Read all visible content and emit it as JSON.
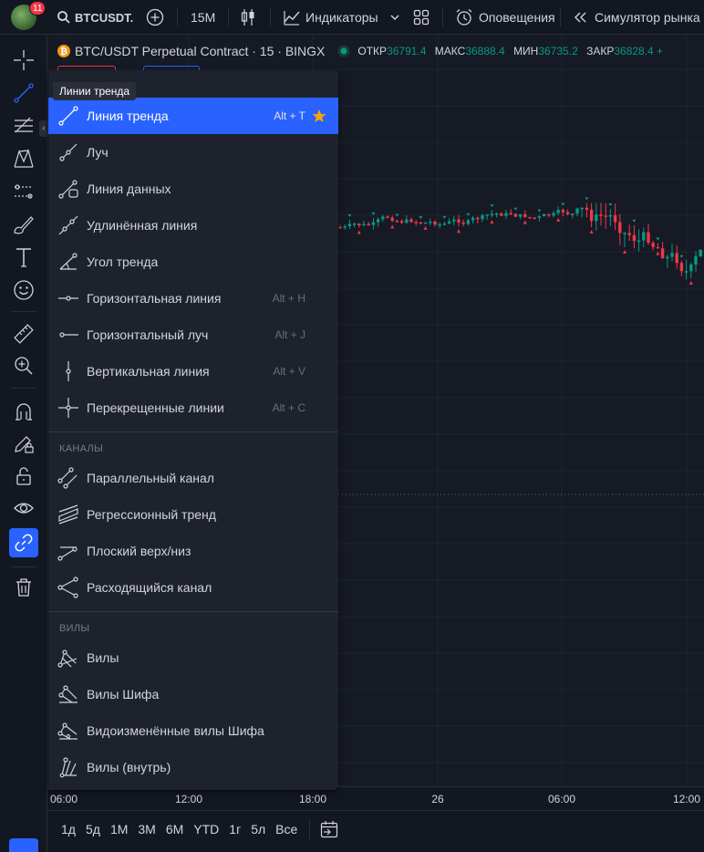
{
  "topbar": {
    "notifications": "11",
    "symbol": "BTCUSDT.",
    "interval": "15M",
    "indicators": "Индикаторы",
    "alerts": "Оповещения",
    "replay": "Симулятор рынка"
  },
  "legend": {
    "title": "BTC/USDT Perpetual Contract · 15 · BINGX",
    "open_label": "ОТКР",
    "open": "36791.4",
    "high_label": "МАКС",
    "high": "36888.4",
    "low_label": "МИН",
    "low": "36735.2",
    "close_label": "ЗАКР",
    "close": "36828.4 +"
  },
  "tooltip": "Линии тренда",
  "menu": {
    "items": [
      {
        "label": "Линия тренда",
        "hotkey": "Alt + T",
        "icon": "trend-line-icon",
        "selected": true
      },
      {
        "label": "Луч",
        "hotkey": "",
        "icon": "ray-icon"
      },
      {
        "label": "Линия данных",
        "hotkey": "",
        "icon": "info-line-icon"
      },
      {
        "label": "Удлинённая линия",
        "hotkey": "",
        "icon": "extended-line-icon"
      },
      {
        "label": "Угол тренда",
        "hotkey": "",
        "icon": "trend-angle-icon"
      },
      {
        "label": "Горизонтальная линия",
        "hotkey": "Alt + H",
        "icon": "horizontal-line-icon"
      },
      {
        "label": "Горизонтальный луч",
        "hotkey": "Alt + J",
        "icon": "horizontal-ray-icon"
      },
      {
        "label": "Вертикальная линия",
        "hotkey": "Alt + V",
        "icon": "vertical-line-icon"
      },
      {
        "label": "Перекрещенные линии",
        "hotkey": "Alt + C",
        "icon": "cross-line-icon"
      }
    ],
    "section_channels": "КАНАЛЫ",
    "channels": [
      {
        "label": "Параллельный канал",
        "icon": "parallel-channel-icon"
      },
      {
        "label": "Регрессионный тренд",
        "icon": "regression-trend-icon"
      },
      {
        "label": "Плоский верх/низ",
        "icon": "flat-top-bottom-icon"
      },
      {
        "label": "Расходящийся канал",
        "icon": "disjoint-channel-icon"
      }
    ],
    "section_pitchforks": "ВИЛЫ",
    "pitchforks": [
      {
        "label": "Вилы",
        "icon": "pitchfork-icon"
      },
      {
        "label": "Вилы Шифа",
        "icon": "schiff-pitchfork-icon"
      },
      {
        "label": "Видоизменённые вилы Шифа",
        "icon": "modified-schiff-pitchfork-icon"
      },
      {
        "label": "Вилы (внутрь)",
        "icon": "inside-pitchfork-icon"
      }
    ]
  },
  "time_axis": [
    "06:00",
    "12:00",
    "18:00",
    "26",
    "06:00",
    "12:00"
  ],
  "ranges": [
    "1д",
    "5д",
    "1М",
    "3М",
    "6М",
    "YTD",
    "1г",
    "5л",
    "Все"
  ],
  "colors": {
    "accent": "#2962ff",
    "up": "#089981",
    "down": "#f23645",
    "star": "#f7a600"
  }
}
